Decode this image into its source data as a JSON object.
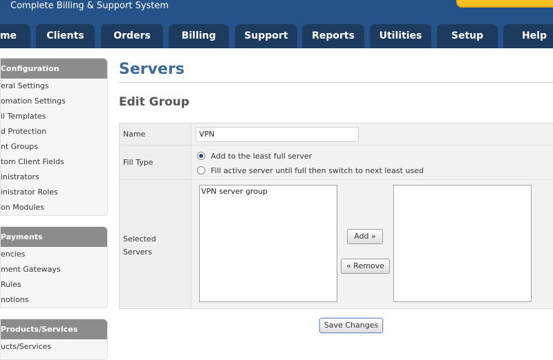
{
  "header": {
    "brand": "Complete Billing & Support System",
    "tabs": [
      {
        "label": "me",
        "key": "home"
      },
      {
        "label": "Clients",
        "key": "clients"
      },
      {
        "label": "Orders",
        "key": "orders"
      },
      {
        "label": "Billing",
        "key": "billing"
      },
      {
        "label": "Support",
        "key": "support"
      },
      {
        "label": "Reports",
        "key": "reports"
      },
      {
        "label": "Utilities",
        "key": "utilities"
      },
      {
        "label": "Setup",
        "key": "setup"
      },
      {
        "label": "Help",
        "key": "help"
      }
    ]
  },
  "sidebar": {
    "sections": [
      {
        "title": "Configuration",
        "items": [
          "eral Settings",
          "omation Settings",
          "il Templates",
          "d Protection",
          "nt Groups",
          "tom Client Fields",
          "inistrators",
          "inistrator Roles",
          "on Modules"
        ]
      },
      {
        "title": "Payments",
        "items": [
          "encies",
          "ment Gateways",
          "Rules",
          "notions"
        ]
      },
      {
        "title": "Products/Services",
        "items": [
          "ucts/Services"
        ]
      }
    ]
  },
  "main": {
    "page_title": "Servers",
    "section_title": "Edit Group",
    "form": {
      "name_label": "Name",
      "name_value": "VPN",
      "fill_type_label": "Fill Type",
      "fill_options": [
        {
          "label": "Add to the least full server",
          "checked": true
        },
        {
          "label": "Fill active server until full then switch to next least used",
          "checked": false
        }
      ],
      "selected_servers_label_line1": "Selected",
      "selected_servers_label_line2": "Servers",
      "available_servers": [
        "VPN server group"
      ],
      "selected_servers": [],
      "add_button": "Add »",
      "remove_button": "« Remove"
    },
    "save_button": "Save Changes"
  },
  "colors": {
    "header_bg": "#255288",
    "tab_bg": "#1c3b5e",
    "title_blue": "#3d6a9b",
    "sidebar_head": "#8c8c8c",
    "search_yellow": "#f7c221"
  }
}
